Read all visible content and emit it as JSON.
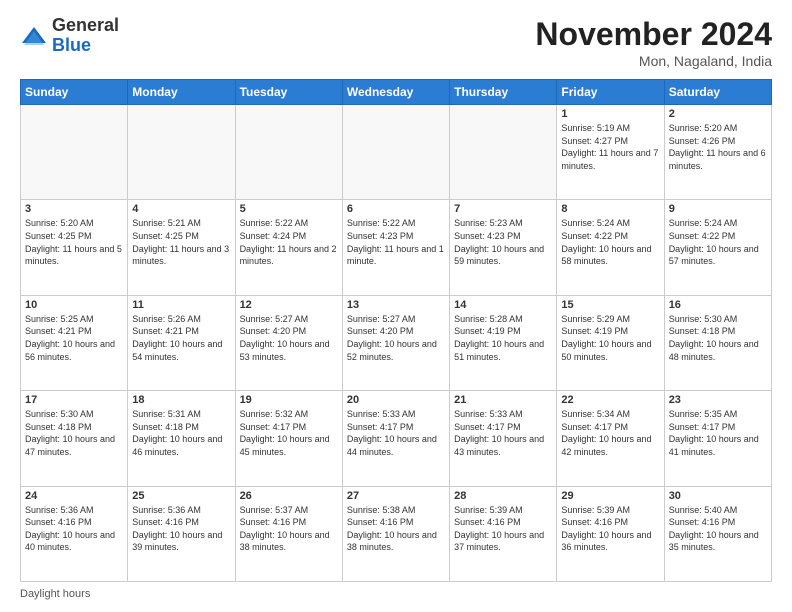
{
  "header": {
    "logo": {
      "general": "General",
      "blue": "Blue"
    },
    "title": "November 2024",
    "subtitle": "Mon, Nagaland, India"
  },
  "calendar": {
    "days_of_week": [
      "Sunday",
      "Monday",
      "Tuesday",
      "Wednesday",
      "Thursday",
      "Friday",
      "Saturday"
    ],
    "weeks": [
      [
        {
          "day": "",
          "info": ""
        },
        {
          "day": "",
          "info": ""
        },
        {
          "day": "",
          "info": ""
        },
        {
          "day": "",
          "info": ""
        },
        {
          "day": "",
          "info": ""
        },
        {
          "day": "1",
          "info": "Sunrise: 5:19 AM\nSunset: 4:27 PM\nDaylight: 11 hours and 7 minutes."
        },
        {
          "day": "2",
          "info": "Sunrise: 5:20 AM\nSunset: 4:26 PM\nDaylight: 11 hours and 6 minutes."
        }
      ],
      [
        {
          "day": "3",
          "info": "Sunrise: 5:20 AM\nSunset: 4:25 PM\nDaylight: 11 hours and 5 minutes."
        },
        {
          "day": "4",
          "info": "Sunrise: 5:21 AM\nSunset: 4:25 PM\nDaylight: 11 hours and 3 minutes."
        },
        {
          "day": "5",
          "info": "Sunrise: 5:22 AM\nSunset: 4:24 PM\nDaylight: 11 hours and 2 minutes."
        },
        {
          "day": "6",
          "info": "Sunrise: 5:22 AM\nSunset: 4:23 PM\nDaylight: 11 hours and 1 minute."
        },
        {
          "day": "7",
          "info": "Sunrise: 5:23 AM\nSunset: 4:23 PM\nDaylight: 10 hours and 59 minutes."
        },
        {
          "day": "8",
          "info": "Sunrise: 5:24 AM\nSunset: 4:22 PM\nDaylight: 10 hours and 58 minutes."
        },
        {
          "day": "9",
          "info": "Sunrise: 5:24 AM\nSunset: 4:22 PM\nDaylight: 10 hours and 57 minutes."
        }
      ],
      [
        {
          "day": "10",
          "info": "Sunrise: 5:25 AM\nSunset: 4:21 PM\nDaylight: 10 hours and 56 minutes."
        },
        {
          "day": "11",
          "info": "Sunrise: 5:26 AM\nSunset: 4:21 PM\nDaylight: 10 hours and 54 minutes."
        },
        {
          "day": "12",
          "info": "Sunrise: 5:27 AM\nSunset: 4:20 PM\nDaylight: 10 hours and 53 minutes."
        },
        {
          "day": "13",
          "info": "Sunrise: 5:27 AM\nSunset: 4:20 PM\nDaylight: 10 hours and 52 minutes."
        },
        {
          "day": "14",
          "info": "Sunrise: 5:28 AM\nSunset: 4:19 PM\nDaylight: 10 hours and 51 minutes."
        },
        {
          "day": "15",
          "info": "Sunrise: 5:29 AM\nSunset: 4:19 PM\nDaylight: 10 hours and 50 minutes."
        },
        {
          "day": "16",
          "info": "Sunrise: 5:30 AM\nSunset: 4:18 PM\nDaylight: 10 hours and 48 minutes."
        }
      ],
      [
        {
          "day": "17",
          "info": "Sunrise: 5:30 AM\nSunset: 4:18 PM\nDaylight: 10 hours and 47 minutes."
        },
        {
          "day": "18",
          "info": "Sunrise: 5:31 AM\nSunset: 4:18 PM\nDaylight: 10 hours and 46 minutes."
        },
        {
          "day": "19",
          "info": "Sunrise: 5:32 AM\nSunset: 4:17 PM\nDaylight: 10 hours and 45 minutes."
        },
        {
          "day": "20",
          "info": "Sunrise: 5:33 AM\nSunset: 4:17 PM\nDaylight: 10 hours and 44 minutes."
        },
        {
          "day": "21",
          "info": "Sunrise: 5:33 AM\nSunset: 4:17 PM\nDaylight: 10 hours and 43 minutes."
        },
        {
          "day": "22",
          "info": "Sunrise: 5:34 AM\nSunset: 4:17 PM\nDaylight: 10 hours and 42 minutes."
        },
        {
          "day": "23",
          "info": "Sunrise: 5:35 AM\nSunset: 4:17 PM\nDaylight: 10 hours and 41 minutes."
        }
      ],
      [
        {
          "day": "24",
          "info": "Sunrise: 5:36 AM\nSunset: 4:16 PM\nDaylight: 10 hours and 40 minutes."
        },
        {
          "day": "25",
          "info": "Sunrise: 5:36 AM\nSunset: 4:16 PM\nDaylight: 10 hours and 39 minutes."
        },
        {
          "day": "26",
          "info": "Sunrise: 5:37 AM\nSunset: 4:16 PM\nDaylight: 10 hours and 38 minutes."
        },
        {
          "day": "27",
          "info": "Sunrise: 5:38 AM\nSunset: 4:16 PM\nDaylight: 10 hours and 38 minutes."
        },
        {
          "day": "28",
          "info": "Sunrise: 5:39 AM\nSunset: 4:16 PM\nDaylight: 10 hours and 37 minutes."
        },
        {
          "day": "29",
          "info": "Sunrise: 5:39 AM\nSunset: 4:16 PM\nDaylight: 10 hours and 36 minutes."
        },
        {
          "day": "30",
          "info": "Sunrise: 5:40 AM\nSunset: 4:16 PM\nDaylight: 10 hours and 35 minutes."
        }
      ]
    ]
  },
  "footer": {
    "text": "Daylight hours"
  }
}
